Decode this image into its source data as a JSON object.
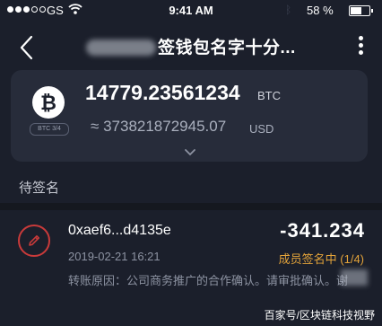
{
  "status_bar": {
    "carrier": "GS",
    "time": "9:41 AM",
    "battery_percent": "58 %",
    "battery_level": 0.58,
    "signal_bars": 3,
    "signal_total": 5,
    "icons": [
      "wifi-icon",
      "bluetooth-icon",
      "battery-icon"
    ]
  },
  "nav": {
    "title": "签钱包名字十分...",
    "icons": [
      "back-chevron-icon",
      "more-vertical-icon"
    ]
  },
  "wallet": {
    "icon": "bitcoin-icon",
    "badge": "BTC 3/4",
    "balance": "14779.23561234",
    "balance_unit": "BTC",
    "fiat_prefix": "≈",
    "fiat_value": "373821872945.07",
    "fiat_unit": "USD",
    "expand_icon": "chevron-down-icon"
  },
  "pending": {
    "section_title": "待签名",
    "items": [
      {
        "icon": "pencil-icon",
        "address": "0xaef6...d4135e",
        "amount": "-341.234",
        "date": "2019-02-21  16:21",
        "status": "成员签名中 (1/4)",
        "reason": "转账原因：公司商务推广的合作确认。请审批确认。谢"
      }
    ]
  },
  "watermark": "百家号/区块链科技视野",
  "colors": {
    "background": "#1b1f2b",
    "card": "#272c3a",
    "accent_red": "#c93a3a",
    "status_orange": "#e3a33a"
  }
}
